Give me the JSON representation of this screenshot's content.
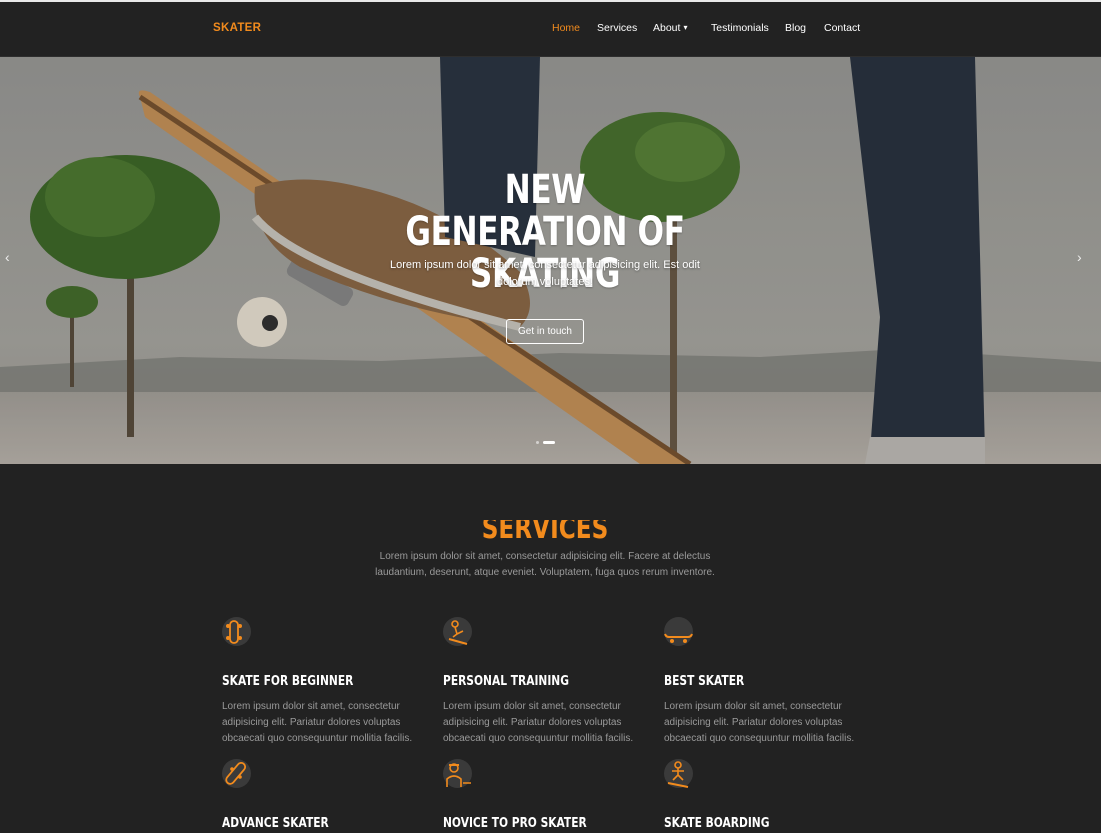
{
  "brand": "SKATER",
  "nav": {
    "items": [
      {
        "label": "Home",
        "active": true
      },
      {
        "label": "Services"
      },
      {
        "label": "About"
      },
      {
        "label": "Testimonials"
      },
      {
        "label": "Blog"
      },
      {
        "label": "Contact"
      }
    ],
    "about_chevron": "⌄"
  },
  "hero": {
    "title_line1": "NEW GENERATION OF",
    "title_line2": "SKATING",
    "subtitle": "Lorem ipsum dolor sit amet, consectetur adipisicing elit. Est odit dolorum voluptates!",
    "button": "Get in touch",
    "prev_arrow": "‹",
    "next_arrow": "›",
    "slides": 2,
    "active_slide": 2
  },
  "services": {
    "title": "SERVICES",
    "subtitle": "Lorem ipsum dolor sit amet, consectetur adipisicing elit. Facere at delectus laudantium, deserunt, atque eveniet. Voluptatem, fuga quos rerum inventore.",
    "items": [
      {
        "icon": "skateboard-top-icon",
        "title": "SKATE FOR BEGINNER",
        "text": "Lorem ipsum dolor sit amet, consectetur adipisicing elit. Pariatur dolores voluptas obcaecati quo consequuntur mollitia facilis."
      },
      {
        "icon": "skater-jump-icon",
        "title": "PERSONAL TRAINING",
        "text": "Lorem ipsum dolor sit amet, consectetur adipisicing elit. Pariatur dolores voluptas obcaecati quo consequuntur mollitia facilis."
      },
      {
        "icon": "skateboard-side-icon",
        "title": "BEST SKATER",
        "text": "Lorem ipsum dolor sit amet, consectetur adipisicing elit. Pariatur dolores voluptas obcaecati quo consequuntur mollitia facilis."
      },
      {
        "icon": "skateboard-tilted-icon",
        "title": "ADVANCE SKATER",
        "text": ""
      },
      {
        "icon": "skater-person-icon",
        "title": "NOVICE TO PRO SKATER",
        "text": ""
      },
      {
        "icon": "skater-trick-icon",
        "title": "SKATE BOARDING",
        "text": ""
      }
    ]
  },
  "colors": {
    "accent": "#f28b1d",
    "background": "#222222",
    "muted_text": "#9a9a9a"
  }
}
